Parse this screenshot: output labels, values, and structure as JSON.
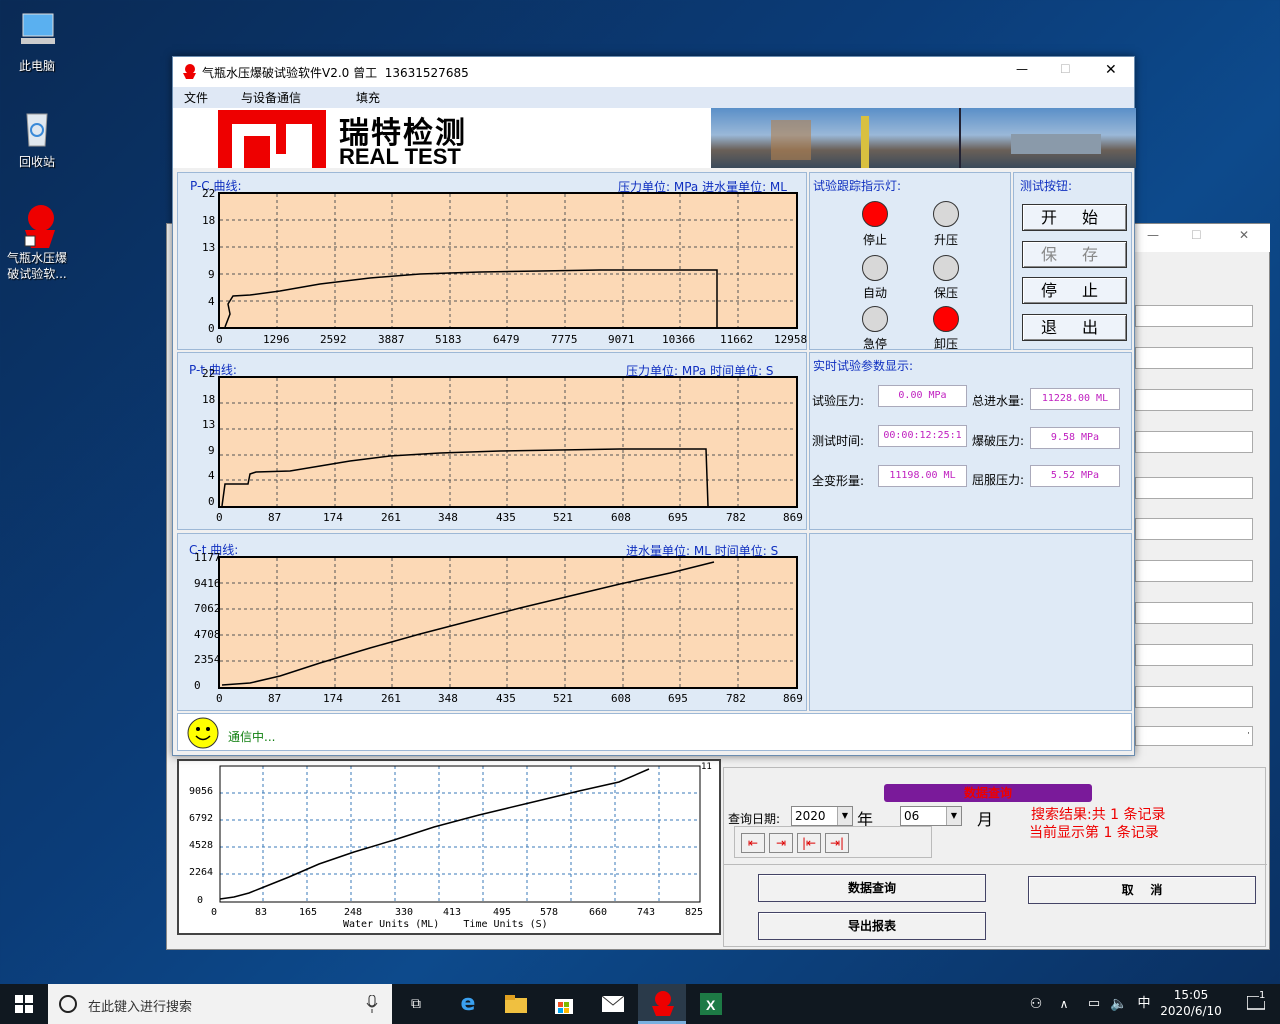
{
  "desktop": {
    "icons": [
      {
        "label": "此电脑"
      },
      {
        "label": "回收站"
      },
      {
        "label1": "气瓶水压爆",
        "label2": "破试验软..."
      }
    ]
  },
  "window": {
    "title": "气瓶水压爆破试验软件V2.0 曾工  13631527685",
    "min": "—",
    "max": "☐",
    "close": "✕"
  },
  "menu": {
    "file": "文件",
    "comm": "与设备通信",
    "fill": "填充"
  },
  "banner": {
    "cn": "瑞特检测",
    "en": "REAL TEST"
  },
  "pc": {
    "title": "P-C 曲线:",
    "units": "压力单位: MPa 进水量单位: ML",
    "yticks": [
      "22",
      "18",
      "13",
      "9",
      "4",
      "0"
    ],
    "xticks": [
      "0",
      "1296",
      "2592",
      "3887",
      "5183",
      "6479",
      "7775",
      "9071",
      "10366",
      "11662",
      "12958"
    ]
  },
  "pt": {
    "title": "P-t 曲线:",
    "units": "压力单位: MPa 时间单位: S",
    "yticks": [
      "22",
      "18",
      "13",
      "9",
      "4",
      "0"
    ],
    "xticks": [
      "0",
      "87",
      "174",
      "261",
      "348",
      "435",
      "521",
      "608",
      "695",
      "782",
      "869"
    ]
  },
  "ct": {
    "title": "C-t 曲线:",
    "units": "进水量单位: ML 时间单位: S",
    "yticks": [
      "1177",
      "9416",
      "7062",
      "4708",
      "2354",
      "0"
    ],
    "xticks": [
      "0",
      "87",
      "174",
      "261",
      "348",
      "435",
      "521",
      "608",
      "695",
      "782",
      "869"
    ]
  },
  "indicator": {
    "title": "试验跟踪指示灯:",
    "lamps": [
      "停止",
      "升压",
      "自动",
      "保压",
      "急停",
      "卸压"
    ]
  },
  "buttons": {
    "title": "测试按钮:",
    "start": "开 始",
    "save": "保 存",
    "stop": "停 止",
    "exit": "退 出"
  },
  "params": {
    "title": "实时试验参数显示:",
    "test_pressure_label": "试验压力:",
    "test_pressure": "0.00 MPa",
    "total_water_label": "总进水量:",
    "total_water": "11228.00 ML",
    "test_time_label": "测试时间:",
    "test_time": "00:00:12:25:1",
    "burst_label": "爆破压力:",
    "burst": "9.58 MPa",
    "deform_label": "全变形量:",
    "deform": "11198.00 ML",
    "yield_label": "屈服压力:",
    "yield": "5.52 MPa"
  },
  "status": {
    "text": "通信中..."
  },
  "lower_chart": {
    "yticks": [
      "9056",
      "6792",
      "4528",
      "2264",
      "0"
    ],
    "corner": "11",
    "xticks": [
      "0",
      "83",
      "165",
      "248",
      "330",
      "413",
      "495",
      "578",
      "660",
      "743",
      "825"
    ],
    "xlabel": "Water Units (ML)    Time Units (S)"
  },
  "query": {
    "header": "数据查询",
    "date_label": "查询日期:",
    "year": "2020",
    "year_unit": "年",
    "month": "06",
    "month_unit": "月",
    "result1": "搜索结果:共 1 条记录",
    "result2": "当前显示第 1 条记录",
    "query_btn": "数据查询",
    "cancel_btn": "取    消",
    "export_btn": "导出报表",
    "nav": [
      "⇤",
      "⇥",
      "|⇤",
      "⇥|"
    ]
  },
  "taskbar": {
    "search": "在此键入进行搜索",
    "ime": "中",
    "time": "15:05",
    "date": "2020/6/10",
    "notif": "1"
  },
  "colors": {
    "lamp_red": "#ff0000",
    "lamp_off": "#d8d8d8",
    "plot_bg": "#fcd9b6",
    "accent": "#1030c0"
  }
}
